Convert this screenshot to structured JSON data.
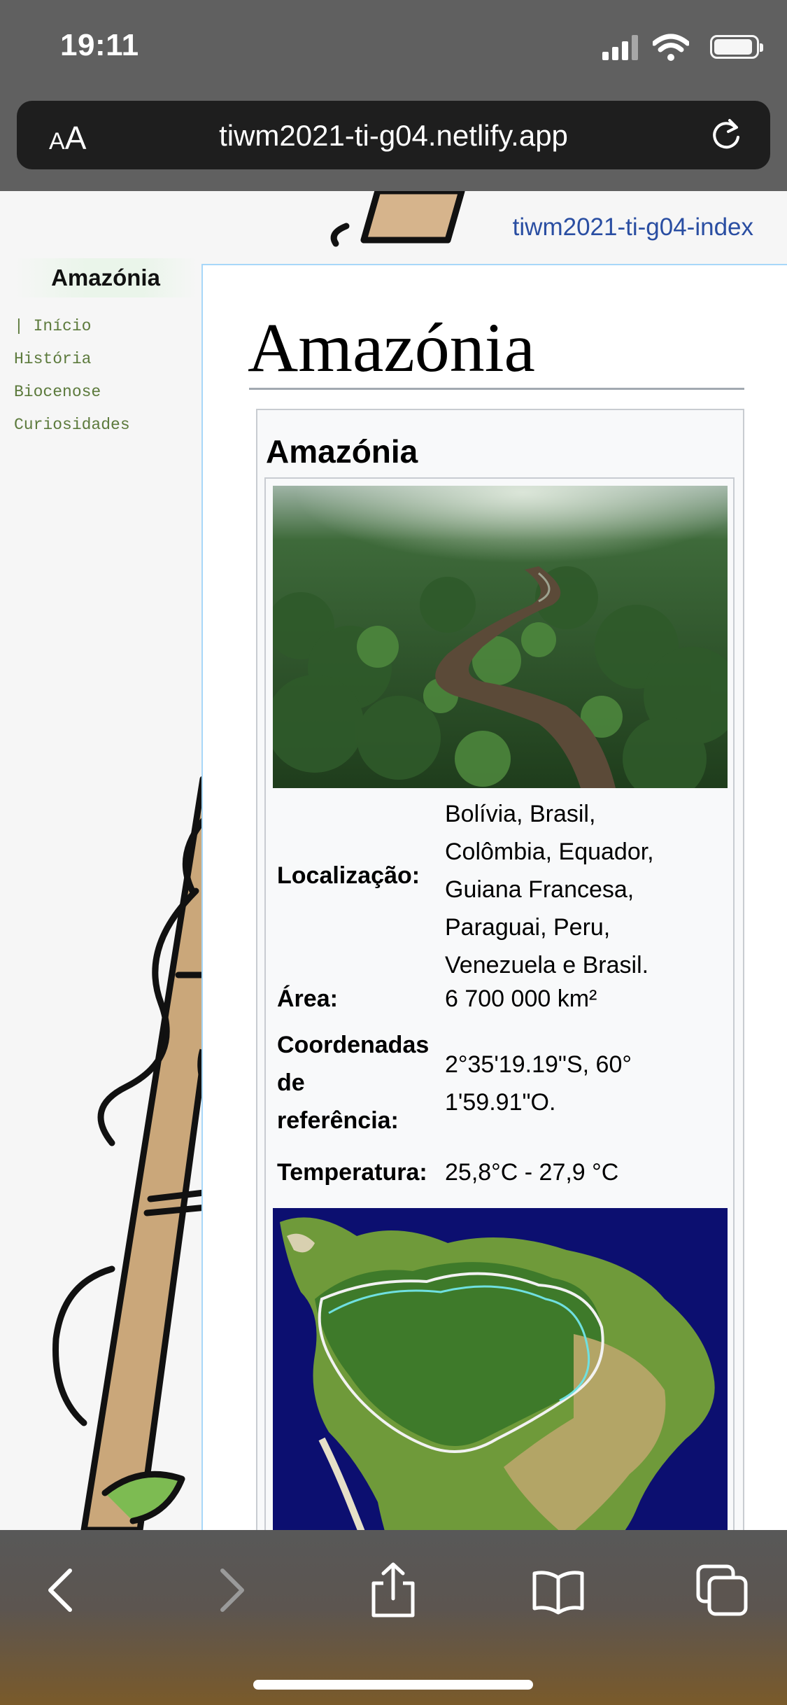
{
  "status_bar": {
    "time": "19:11"
  },
  "address_bar": {
    "text_size_small": "A",
    "text_size_large": "A",
    "url": "tiwm2021-ti-g04.netlify.app"
  },
  "page": {
    "index_link": "tiwm2021-ti-g04-index",
    "sidebar": {
      "title": "Amazónia",
      "nav": [
        {
          "label": "| Início"
        },
        {
          "label": "História"
        },
        {
          "label": "Biocenose"
        },
        {
          "label": "Curiosidades"
        }
      ]
    },
    "heading": "Amazónia",
    "infobox": {
      "title": "Amazónia",
      "rows": [
        {
          "key": "Localização:",
          "value_lines": [
            "Bolívia, Brasil,",
            "Colômbia, Equador,",
            "Guiana Francesa,",
            "Paraguai, Peru,",
            "Venezuela e Brasil."
          ]
        },
        {
          "key": "Área:",
          "value_lines": [
            "6 700 000 km²"
          ]
        },
        {
          "key_lines": [
            "Coordenadas",
            "de",
            "referência:"
          ],
          "value_lines": [
            "2°35'19.19\"S, 60°",
            "1'59.91\"O."
          ]
        },
        {
          "key": "Temperatura:",
          "value_lines": [
            "25,8°C - 27,9 °C"
          ]
        }
      ]
    }
  },
  "colors": {
    "link": "#2a4ea2",
    "sidebar_link": "#5c7a3c",
    "content_border": "#a7d7f9"
  },
  "toolbar": {
    "icons": [
      "back-icon",
      "forward-icon",
      "share-icon",
      "bookmarks-icon",
      "tabs-icon"
    ]
  }
}
